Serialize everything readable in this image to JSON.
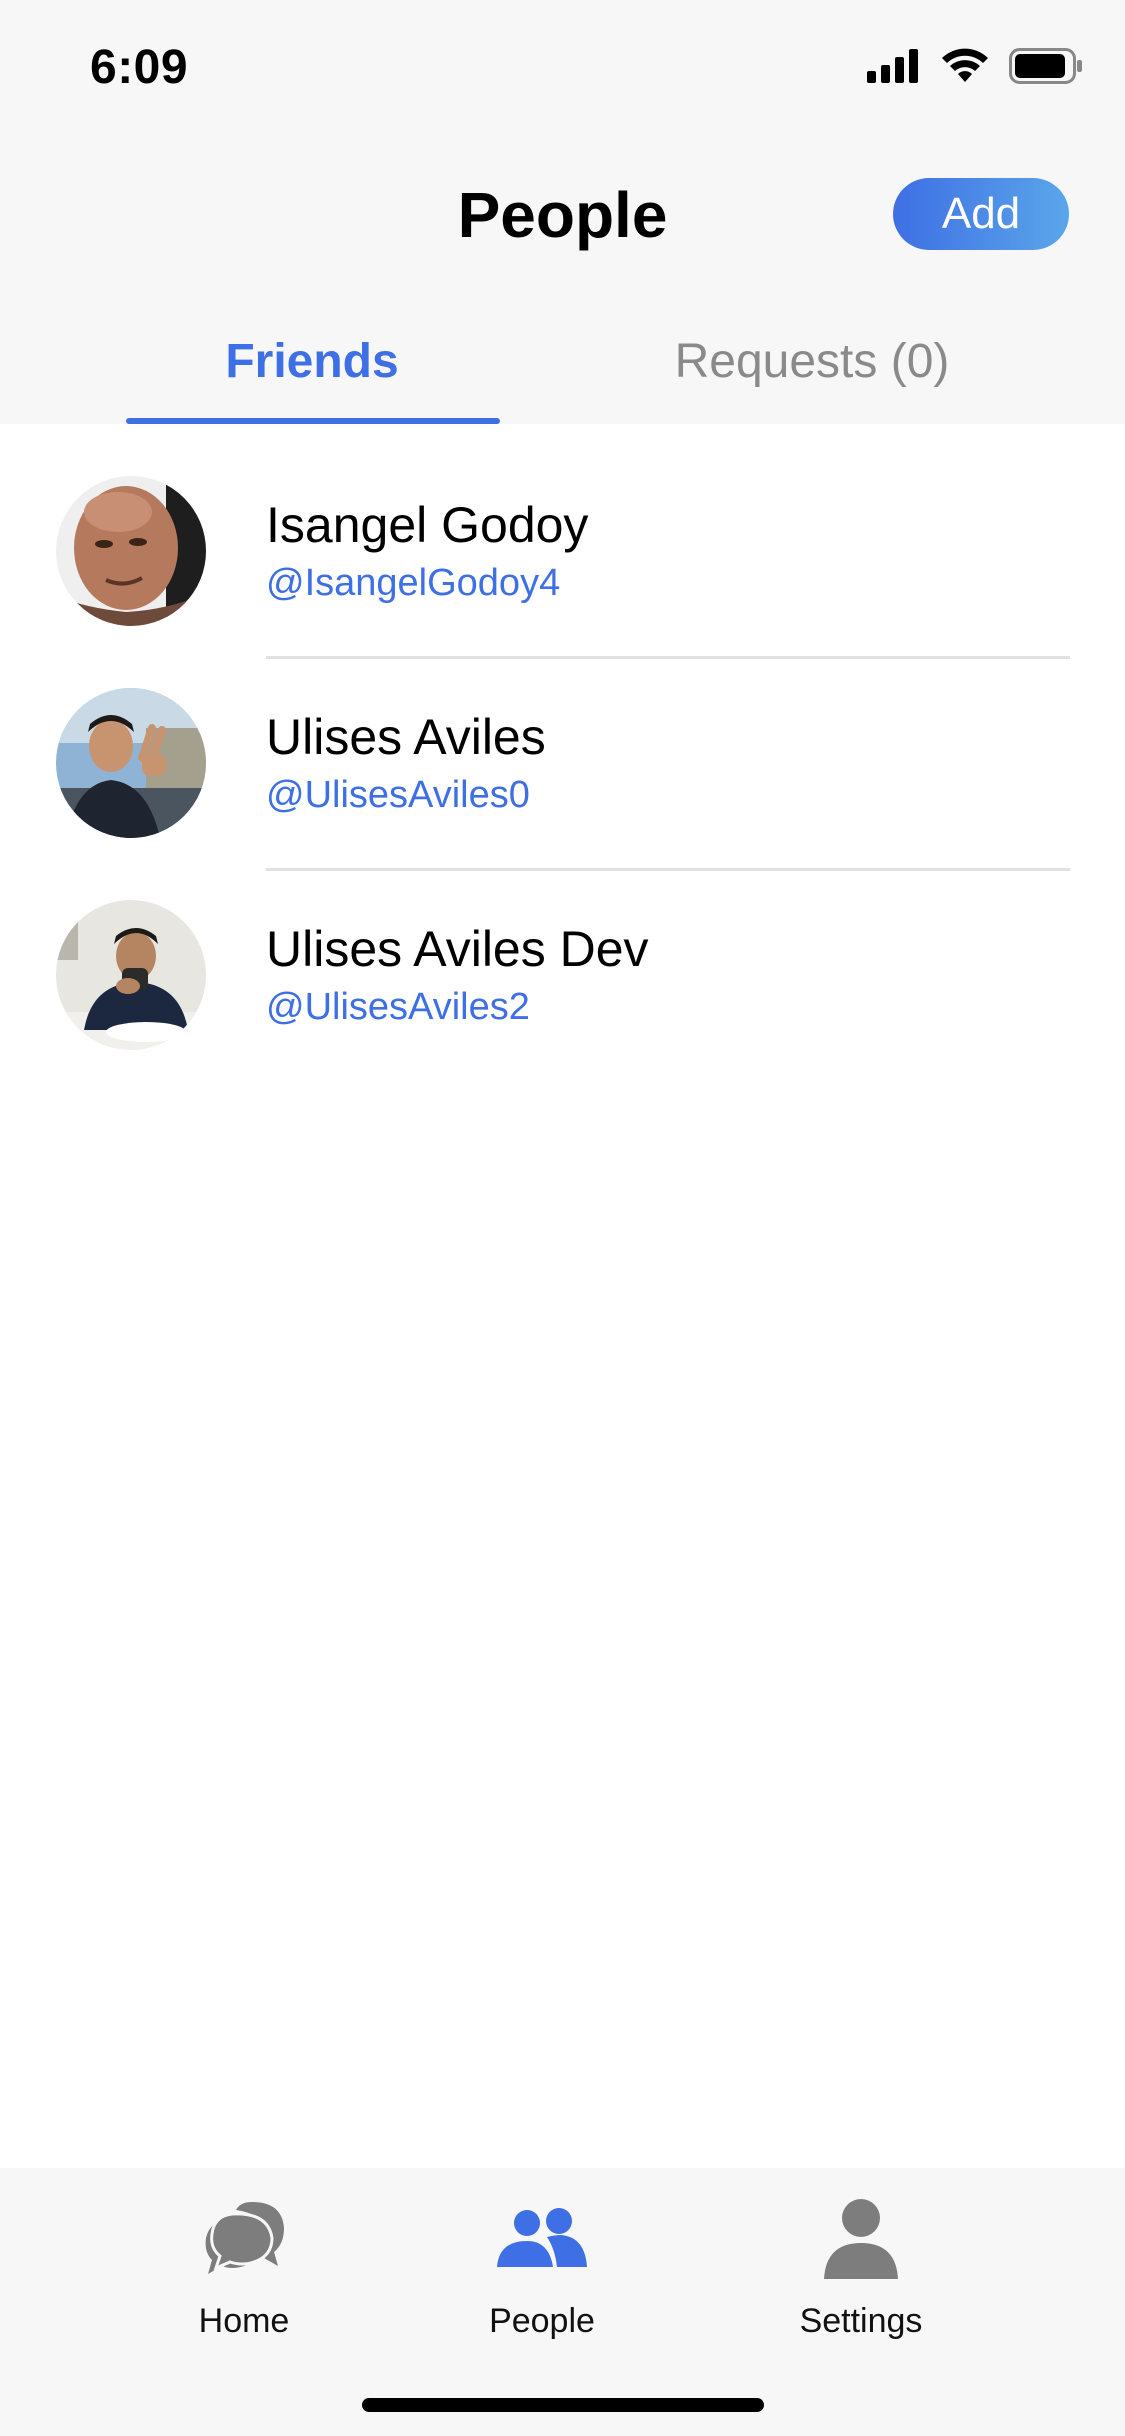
{
  "status_bar": {
    "time": "6:09",
    "icons": [
      "cellular-signal-icon",
      "wifi-icon",
      "battery-icon"
    ]
  },
  "header": {
    "title": "People",
    "add_label": "Add"
  },
  "tabs": [
    {
      "label": "Friends",
      "active": true
    },
    {
      "label": "Requests (0)",
      "active": false
    }
  ],
  "friends": [
    {
      "name": "Isangel Godoy",
      "handle": "@IsangelGodoy4"
    },
    {
      "name": "Ulises Aviles",
      "handle": "@UlisesAviles0"
    },
    {
      "name": "Ulises Aviles Dev",
      "handle": "@UlisesAviles2"
    }
  ],
  "tab_bar": {
    "items": [
      {
        "label": "Home",
        "icon": "chat-bubbles-icon",
        "active": false
      },
      {
        "label": "People",
        "icon": "people-icon",
        "active": true
      },
      {
        "label": "Settings",
        "icon": "person-icon",
        "active": false
      }
    ]
  },
  "colors": {
    "accent": "#3e6fe4",
    "add_gradient_end": "#5aa6ea",
    "inactive_text": "#8a8a8a",
    "inactive_icon": "#7d7d7d",
    "bar_background": "#f7f7f7",
    "divider": "#e1e1e1"
  }
}
